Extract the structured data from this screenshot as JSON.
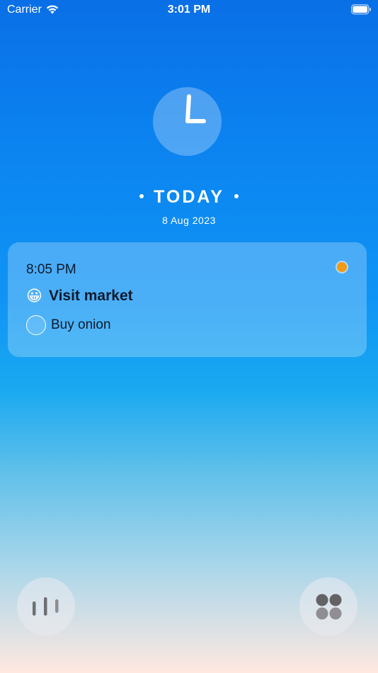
{
  "status_bar": {
    "carrier": "Carrier",
    "time": "3:01 PM",
    "wifi_icon": "wifi-icon",
    "battery_icon": "battery-full-icon"
  },
  "header": {
    "icon": "clock-icon",
    "title": "TODAY",
    "date": "8 Aug 2023"
  },
  "task": {
    "time": "8:05 PM",
    "emoji": "😀",
    "title": "Visit market",
    "status_color": "#f29a13",
    "subtasks": [
      {
        "label": "Buy onion",
        "checked": false
      }
    ]
  },
  "bottom_bar": {
    "left_icon": "stats-bars-icon",
    "right_icon": "apps-grid-icon"
  },
  "colors": {
    "gradient_top": "#0a6fe6",
    "gradient_bottom": "#ffe8e0",
    "accent_orange": "#f29a13"
  }
}
